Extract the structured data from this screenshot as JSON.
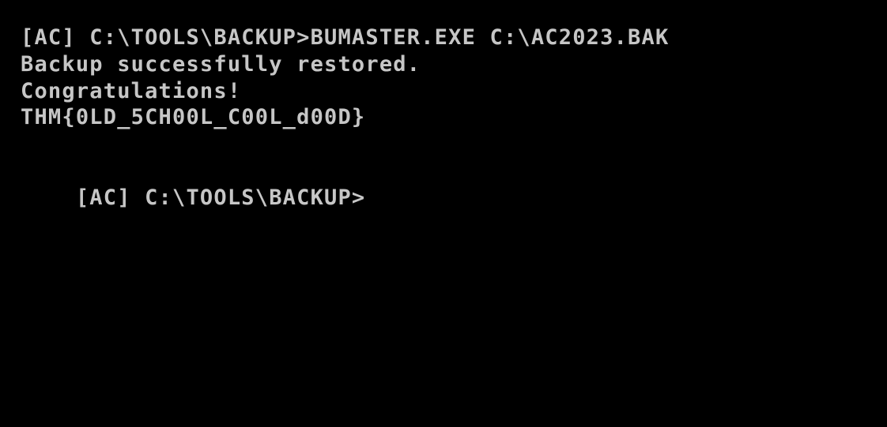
{
  "terminal": {
    "colors": {
      "background": "#000000",
      "foreground": "#c6c6c6"
    },
    "lines": [
      "[AC] C:\\TOOLS\\BACKUP>BUMASTER.EXE C:\\AC2023.BAK",
      "Backup successfully restored.",
      "Congratulations!",
      "THM{0LD_5CH00L_C00L_d00D}",
      ""
    ],
    "prompt": "[AC] C:\\TOOLS\\BACKUP>"
  }
}
